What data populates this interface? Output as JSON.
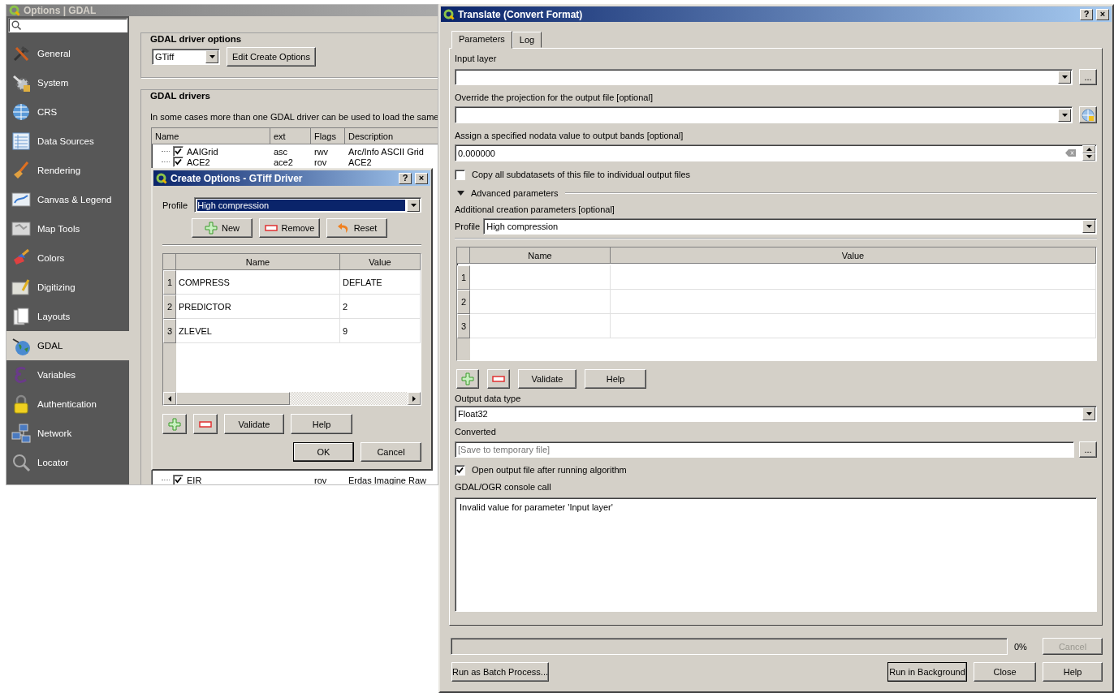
{
  "options_window": {
    "title": "Options | GDAL",
    "sidebar": [
      {
        "label": "General",
        "selected": false
      },
      {
        "label": "System",
        "selected": false
      },
      {
        "label": "CRS",
        "selected": false
      },
      {
        "label": "Data Sources",
        "selected": false
      },
      {
        "label": "Rendering",
        "selected": false
      },
      {
        "label": "Canvas & Legend",
        "selected": false
      },
      {
        "label": "Map Tools",
        "selected": false
      },
      {
        "label": "Colors",
        "selected": false
      },
      {
        "label": "Digitizing",
        "selected": false
      },
      {
        "label": "Layouts",
        "selected": false
      },
      {
        "label": "GDAL",
        "selected": true
      },
      {
        "label": "Variables",
        "selected": false
      },
      {
        "label": "Authentication",
        "selected": false
      },
      {
        "label": "Network",
        "selected": false
      },
      {
        "label": "Locator",
        "selected": false
      }
    ],
    "driver_options": {
      "title": "GDAL driver options",
      "driver": "GTiff",
      "edit_button": "Edit Create Options"
    },
    "drivers": {
      "title": "GDAL drivers",
      "note": "In some cases more than one GDAL driver can be used to load the same",
      "columns": [
        "Name",
        "ext",
        "Flags",
        "Description"
      ],
      "rows": [
        {
          "name": "AAIGrid",
          "ext": "asc",
          "flags": "rwv",
          "description": "Arc/Info ASCII Grid",
          "checked": true
        },
        {
          "name": "ACE2",
          "ext": "ace2",
          "flags": "rov",
          "description": "ACE2",
          "checked": true
        },
        {
          "name": "EIR",
          "flags": "rov",
          "description": "Erdas Imagine Raw",
          "checked": true
        }
      ]
    }
  },
  "create_options_dialog": {
    "title": "Create Options - GTiff Driver",
    "title_buttons": [
      "?",
      "×"
    ],
    "profile_label": "Profile",
    "profile": "High compression",
    "profile_highlighted": true,
    "profile_buttons": [
      {
        "label": "New",
        "kind": "add"
      },
      {
        "label": "Remove",
        "kind": "remove"
      },
      {
        "label": "Reset",
        "kind": "reset"
      }
    ],
    "columns": [
      "Name",
      "Value"
    ],
    "rows": [
      {
        "number": "1",
        "name": "COMPRESS",
        "value": "DEFLATE"
      },
      {
        "number": "2",
        "name": "PREDICTOR",
        "value": "2"
      },
      {
        "number": "3",
        "name": "ZLEVEL",
        "value": "9"
      }
    ],
    "buttons": [
      "Validate",
      "Help"
    ],
    "ok": "OK",
    "cancel": "Cancel"
  },
  "translate_window": {
    "title": "Translate (Convert Format)",
    "title_buttons": [
      "?",
      "×"
    ],
    "tabs": [
      {
        "label": "Parameters",
        "selected": true
      },
      {
        "label": "Log",
        "selected": false
      }
    ],
    "input_layer": {
      "label": "Input layer",
      "browse": "..."
    },
    "projection": {
      "label": "Override the projection for the output file [optional]"
    },
    "nodata": {
      "label": "Assign a specified nodata value to output bands [optional]",
      "value": "0.000000"
    },
    "copy_subdatasets": {
      "label": "Copy all subdatasets of this file to individual output files",
      "checked": false
    },
    "advanced": {
      "label": "Advanced parameters",
      "expanded": true
    },
    "creation": {
      "label": "Additional creation parameters [optional]",
      "profile_label": "Profile",
      "profile": "High compression",
      "columns": [
        "Name",
        "Value"
      ],
      "rows": [
        "1",
        "2",
        "3"
      ],
      "buttons": [
        "Validate",
        "Help"
      ]
    },
    "output_type": {
      "label": "Output data type",
      "value": "Float32"
    },
    "converted": {
      "label": "Converted",
      "placeholder": "[Save to temporary file]",
      "browse": "..."
    },
    "open_output": {
      "label": "Open output file after running algorithm",
      "checked": true
    },
    "console": {
      "label": "GDAL/OGR console call",
      "text": "Invalid value for parameter 'Input layer'"
    },
    "progress": {
      "level": 0,
      "reading": "0%",
      "cancel": "Cancel",
      "cancel_disabled": true
    },
    "buttons": {
      "batch": "Run as Batch Process...",
      "background": "Run in Background",
      "close": "Close",
      "help": "Help"
    }
  }
}
